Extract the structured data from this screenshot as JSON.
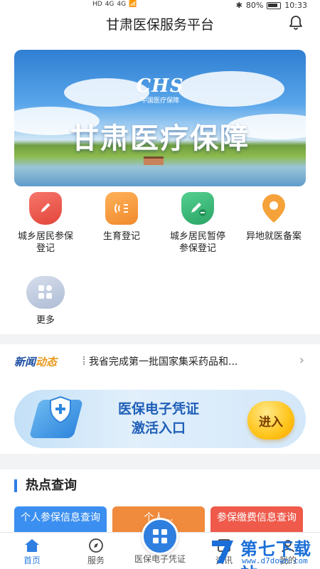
{
  "status_bar": {
    "left_a": "HD",
    "left_b": "4G",
    "left_c": "4G",
    "battery": "80%",
    "time": "10:33"
  },
  "header": {
    "title": "甘肃医保服务平台",
    "bell_icon": "bell-icon"
  },
  "banner": {
    "logo": "CHS",
    "logo_sub": "中国医疗保障",
    "title": "甘肃医疗保障"
  },
  "services": [
    {
      "label": "城乡居民参保登记",
      "icon": "pen-shield-icon",
      "color": "#ef5a4b"
    },
    {
      "label": "生育登记",
      "icon": "waves-icon",
      "color": "#f59a3a"
    },
    {
      "label": "城乡居民暂停参保登记",
      "icon": "pen-minus-icon",
      "color": "#35b577"
    },
    {
      "label": "异地就医备案",
      "icon": "location-icon",
      "color": "#f5a23a"
    },
    {
      "label": "更多",
      "icon": "more-grid-icon",
      "color": "#b5c3dc"
    }
  ],
  "news": {
    "tag_a": "新闻",
    "tag_b": "动态",
    "text": "我省完成第一批国家集采药品和..."
  },
  "voucher": {
    "line1": "医保电子凭证",
    "line2": "激活入口",
    "button": "进入"
  },
  "hot": {
    "title": "热点查询",
    "cards": [
      {
        "label": "个人参保信息查询",
        "color": "#3b8ff0"
      },
      {
        "label": "个人...",
        "color": "#f08a3c"
      },
      {
        "label": "参保缴费信息查询",
        "color": "#ef5a4b"
      }
    ]
  },
  "bottom_nav": {
    "items": [
      {
        "label": "首页",
        "icon": "home-icon"
      },
      {
        "label": "服务",
        "icon": "compass-icon"
      },
      {
        "label": "医保电子凭证",
        "icon": "qr-grid-icon"
      },
      {
        "label": "资讯",
        "icon": "news-icon"
      },
      {
        "label": "我的",
        "icon": "user-icon"
      }
    ]
  },
  "watermark": {
    "title": "第七下载站",
    "url": "www.d7down.com"
  }
}
